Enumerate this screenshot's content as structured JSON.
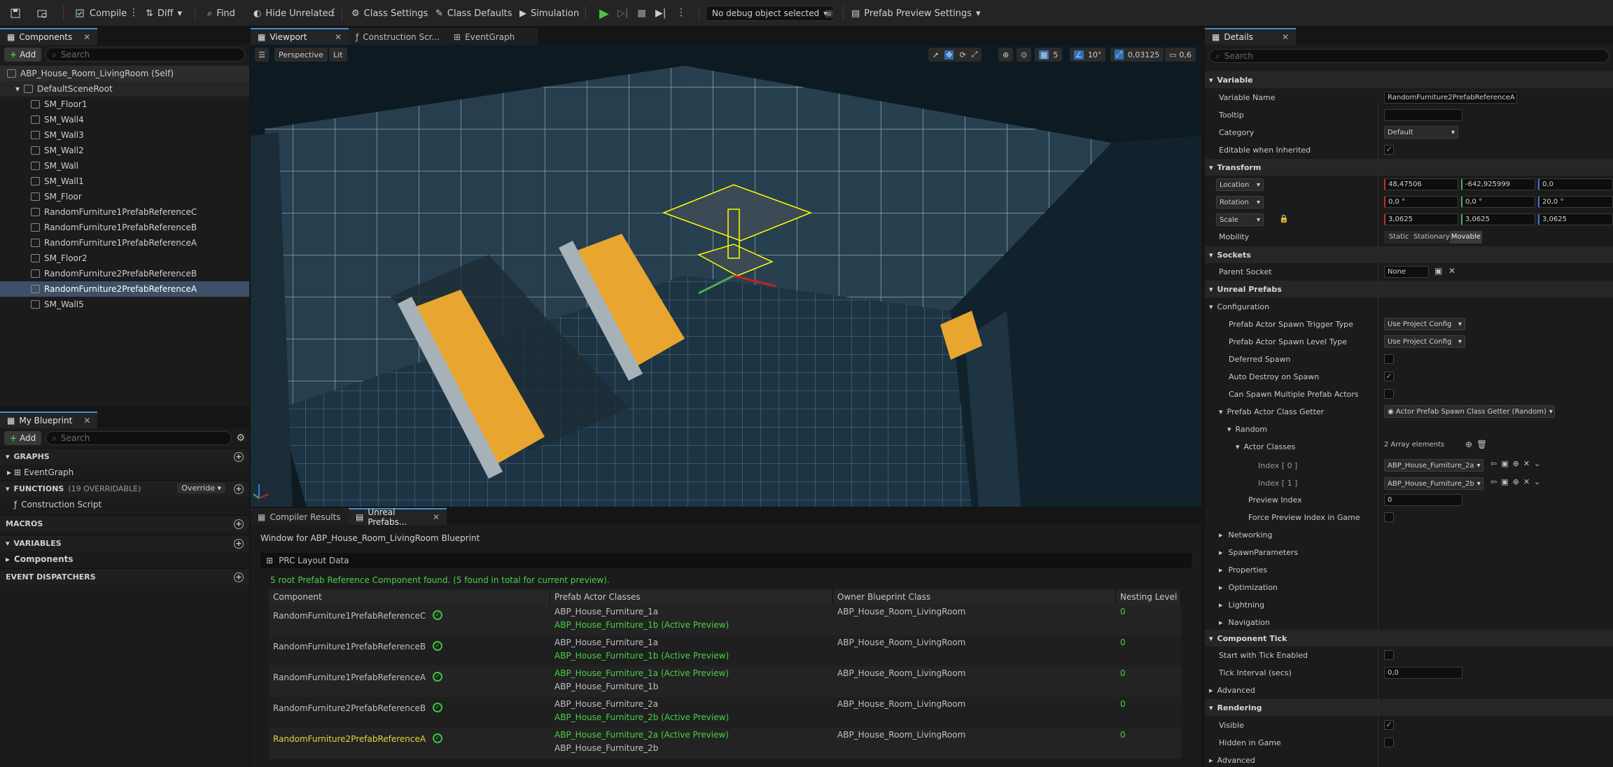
{
  "toolbar": {
    "compile": "Compile",
    "diff": "Diff",
    "find": "Find",
    "hide_unrelated": "Hide Unrelated",
    "class_settings": "Class Settings",
    "class_defaults": "Class Defaults",
    "simulation": "Simulation",
    "debug_object": "No debug object selected",
    "prefab_preview": "Prefab Preview Settings"
  },
  "components": {
    "tab": "Components",
    "add": "Add",
    "search_placeholder": "Search",
    "root": "ABP_House_Room_LivingRoom (Self)",
    "scene_root": "DefaultSceneRoot",
    "items": [
      "SM_Floor1",
      "SM_Wall4",
      "SM_Wall3",
      "SM_Wall2",
      "SM_Wall",
      "SM_Wall1",
      "SM_Floor",
      "RandomFurniture1PrefabReferenceC",
      "RandomFurniture1PrefabReferenceB",
      "RandomFurniture1PrefabReferenceA",
      "SM_Floor2",
      "RandomFurniture2PrefabReferenceB",
      "RandomFurniture2PrefabReferenceA",
      "SM_Wall5"
    ],
    "selected_index": 12
  },
  "my_blueprint": {
    "tab": "My Blueprint",
    "add": "Add",
    "search_placeholder": "Search",
    "graphs": "GRAPHS",
    "event_graph": "EventGraph",
    "functions": "FUNCTIONS",
    "functions_count": "(19 OVERRIDABLE)",
    "override": "Override",
    "construction_script": "Construction Script",
    "macros": "MACROS",
    "variables": "VARIABLES",
    "components": "Components",
    "event_dispatchers": "EVENT DISPATCHERS"
  },
  "editor_tabs": [
    "Viewport",
    "Construction Scr...",
    "EventGraph"
  ],
  "viewport": {
    "perspective": "Perspective",
    "lit": "Lit",
    "grid_size": "5",
    "rot_snap": "10°",
    "scale_snap": "0,03125",
    "cam_speed": "0,6"
  },
  "bottom": {
    "tabs": [
      "Compiler Results",
      "Unreal Prefabs..."
    ],
    "window_title": "Window for ABP_House_Room_LivingRoom Blueprint",
    "prc_layout": "PRC Layout Data",
    "status": "5 root Prefab Reference Component found. (5 found in total for current preview).",
    "headers": [
      "Component",
      "Prefab Actor Classes",
      "Owner Blueprint Class",
      "Nesting Level"
    ],
    "rows": [
      {
        "component": "RandomFurniture1PrefabReferenceC",
        "class1": "ABP_House_Furniture_1a",
        "class2": "ABP_House_Furniture_1b (Active Preview)",
        "owner": "ABP_House_Room_LivingRoom",
        "level": "0"
      },
      {
        "component": "RandomFurniture1PrefabReferenceB",
        "class1": "ABP_House_Furniture_1a",
        "class2": "ABP_House_Furniture_1b (Active Preview)",
        "owner": "ABP_House_Room_LivingRoom",
        "level": "0"
      },
      {
        "component": "RandomFurniture1PrefabReferenceA",
        "class1": "ABP_House_Furniture_1a (Active Preview)",
        "class2": "ABP_House_Furniture_1b",
        "owner": "ABP_House_Room_LivingRoom",
        "level": "0"
      },
      {
        "component": "RandomFurniture2PrefabReferenceB",
        "class1": "ABP_House_Furniture_2a",
        "class2": "ABP_House_Furniture_2b (Active Preview)",
        "owner": "ABP_House_Room_LivingRoom",
        "level": "0"
      },
      {
        "component": "RandomFurniture2PrefabReferenceA",
        "class1": "ABP_House_Furniture_2a (Active Preview)",
        "class2": "ABP_House_Furniture_2b",
        "owner": "ABP_House_Room_LivingRoom",
        "level": "0"
      }
    ]
  },
  "details": {
    "tab": "Details",
    "search_placeholder": "Search",
    "variable": "Variable",
    "variable_name_label": "Variable Name",
    "variable_name": "RandomFurniture2PrefabReferenceA",
    "tooltip": "Tooltip",
    "category": "Category",
    "category_value": "Default",
    "editable_inherited": "Editable when Inherited",
    "transform": "Transform",
    "location": "Location",
    "loc": [
      "48,47506",
      "-642,925999",
      "0,0"
    ],
    "rotation": "Rotation",
    "rot": [
      "0,0 °",
      "0,0 °",
      "20,0 °"
    ],
    "scale": "Scale",
    "scl": [
      "3,0625",
      "3,0625",
      "3,0625"
    ],
    "mobility": "Mobility",
    "mob": [
      "Static",
      "Stationary",
      "Movable"
    ],
    "sockets": "Sockets",
    "parent_socket": "Parent Socket",
    "parent_socket_value": "None",
    "unreal_prefabs": "Unreal Prefabs",
    "configuration": "Configuration",
    "trigger_type": "Prefab Actor Spawn Trigger Type",
    "trigger_value": "Use Project Config",
    "level_type": "Prefab Actor Spawn Level Type",
    "level_value": "Use Project Config",
    "deferred": "Deferred Spawn",
    "auto_destroy": "Auto Destroy on Spawn",
    "can_spawn_multiple": "Can Spawn Multiple Prefab Actors",
    "class_getter": "Prefab Actor Class Getter",
    "class_getter_value": "Actor Prefab Spawn Class Getter (Random)",
    "random": "Random",
    "actor_classes": "Actor Classes",
    "array_count": "2 Array elements",
    "index0": "Index [ 0 ]",
    "index0_value": "ABP_House_Furniture_2a",
    "index1": "Index [ 1 ]",
    "index1_value": "ABP_House_Furniture_2b",
    "preview_index": "Preview Index",
    "preview_index_value": "0",
    "force_preview": "Force Preview Index in Game",
    "collapsed": [
      "Networking",
      "SpawnParameters",
      "Properties",
      "Optimization",
      "Lightning",
      "Navigation"
    ],
    "component_tick": "Component Tick",
    "start_tick": "Start with Tick Enabled",
    "tick_interval": "Tick Interval (secs)",
    "tick_interval_value": "0,0",
    "advanced": "Advanced",
    "rendering": "Rendering",
    "visible": "Visible",
    "hidden_in_game": "Hidden in Game",
    "advanced2": "Advanced"
  }
}
